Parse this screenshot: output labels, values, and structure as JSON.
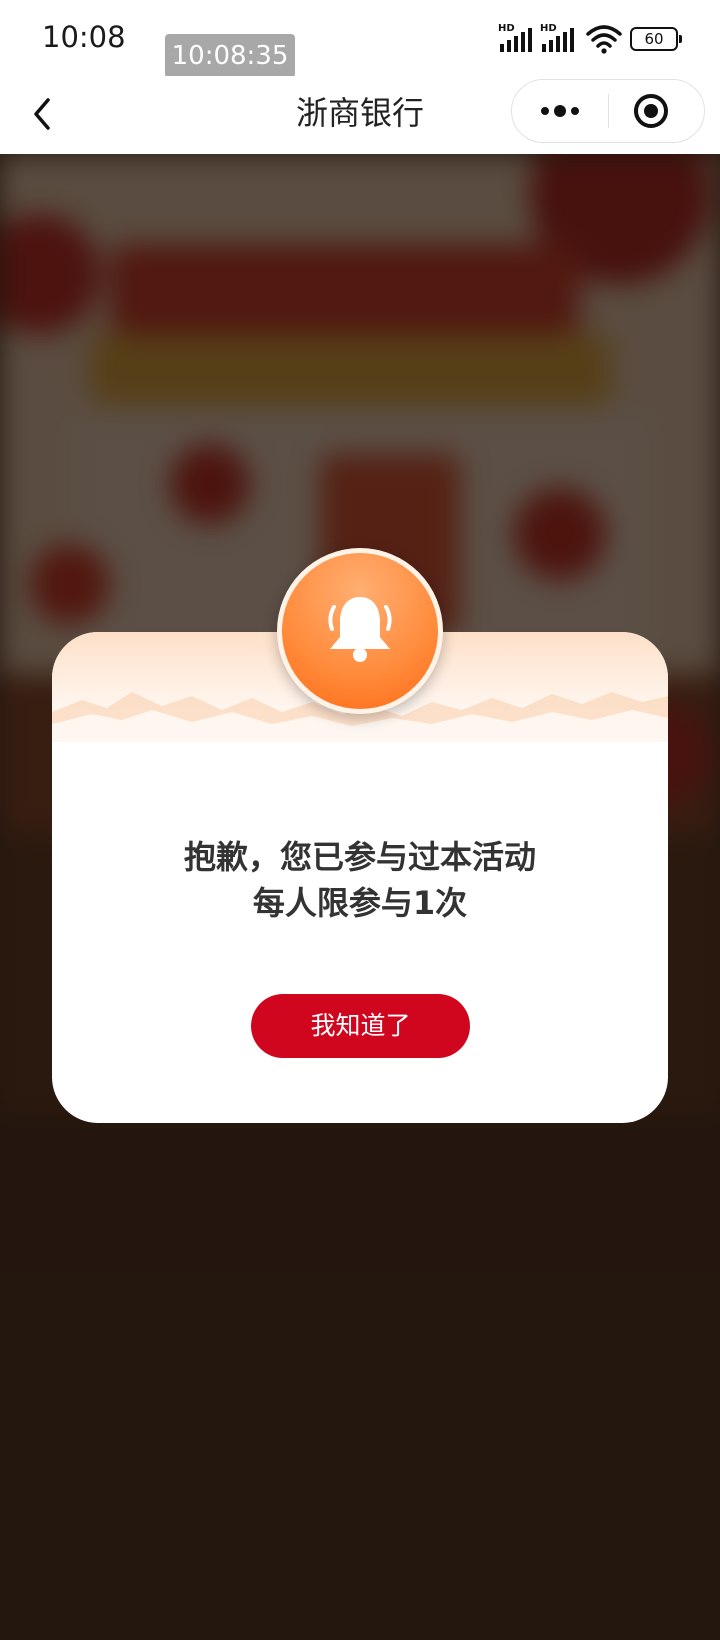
{
  "status_bar": {
    "time": "10:08",
    "time_overlay": "10:08:35",
    "network_label": "HD",
    "battery": "60"
  },
  "nav": {
    "title": "浙商银行",
    "icons": [
      "back-arrow-icon",
      "more-icon",
      "close-mini-program-icon"
    ]
  },
  "modal": {
    "icon": "bell-icon",
    "message_line1": "抱歉，您已参与过本活动",
    "message_line2": "每人限参与1次",
    "button_label": "我知道了"
  },
  "colors": {
    "button": "#d0061f",
    "bell_badge": "#ff8a3a",
    "overlay": "#33231a"
  }
}
